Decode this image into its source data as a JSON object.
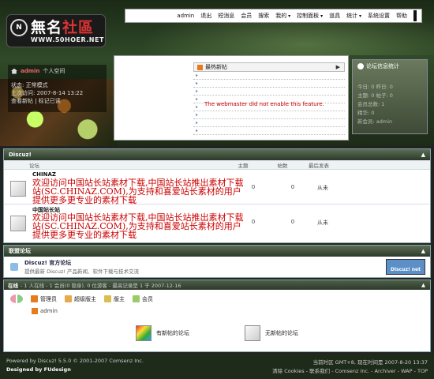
{
  "logo": {
    "mark": "N",
    "title_main": "無名",
    "title_accent": "社區",
    "url": "WWW.50HOER.NET"
  },
  "topnav": {
    "items": [
      "admin",
      "退出",
      "短消息",
      "会员",
      "搜索",
      "我的",
      "控制面板",
      "道具",
      "统计",
      "系统设置",
      "帮助"
    ],
    "dropdown": [
      "我的",
      "控制面板",
      "统计"
    ]
  },
  "user": {
    "name": "admin",
    "space": "个人空间",
    "status": "状态: 正常模式",
    "last_visit": "上次访问: 2007-8-14 13:22",
    "links": "查看新帖 | 标记已读"
  },
  "hot": {
    "title": "最热新帖",
    "message": "The webmaster did not enable this feature."
  },
  "stats": {
    "title": "论坛信息统计",
    "lines": [
      "今日: 0 昨日: 0",
      "主题: 0 帖子: 0",
      "会员总数: 1",
      "精华: 0",
      "新会员: admin"
    ]
  },
  "discuz": {
    "section_title": "Discuz!",
    "columns": {
      "forum": "论坛",
      "topics": "主题",
      "posts": "帖数",
      "last": "最后发表"
    },
    "forums": [
      {
        "name": "CHINAZ",
        "desc": "欢迎访问中国站长站素材下载,中国站长站推出素材下载站(SC.CHINAZ.COM),为支持和喜爱站长素材的用户提供更多更专业的素材下载",
        "topics": "0",
        "posts": "0",
        "last": "从未"
      },
      {
        "name": "中国站长站",
        "desc": "欢迎访问中国站长站素材下载,中国站长站推出素材下载站(SC.CHINAZ.COM),为支持和喜爱站长素材的用户提供更多更专业的素材下载",
        "topics": "0",
        "posts": "0",
        "last": "从未"
      }
    ]
  },
  "links": {
    "section_title": "联盟论坛",
    "name": "Discuz! 官方论坛",
    "desc": "提供最新  Discuz! 产品新闻、软件下载与技术交流",
    "badge": "Discuz! net"
  },
  "online": {
    "label": "在线",
    "text": "- 1 人在线 - 1 会员(0 隐身), 0 位游客 - 最高记录是 1 于 2007-12-16",
    "legend": [
      "管理员",
      "超级版主",
      "版主",
      "会员"
    ],
    "user": "admin",
    "icons": [
      "有新帖的论坛",
      "无新帖的论坛"
    ]
  },
  "footer": {
    "left1": "Powered by Discuz! 5.5.0 © 2001-2007 Comsenz Inc.",
    "left2": "Designed by FUdesign",
    "right1": "当前时区 GMT+8, 现在时间是 2007-8-20 13:37",
    "right2": "清除 Cookies - 联系我们 - Comsenz Inc. - Archiver - WAP - TOP"
  },
  "colors": {
    "accent": "#cc0000",
    "header_dark": "#2b3b2b",
    "link_blue": "#5d8fc7"
  }
}
